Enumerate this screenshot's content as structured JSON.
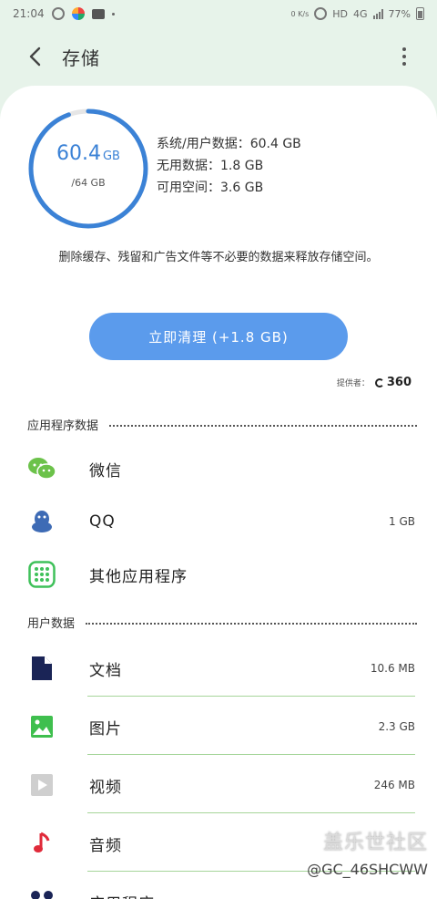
{
  "status_bar": {
    "time": "21:04",
    "net_speed": "0 K/s",
    "hd": "HD",
    "network": "4G",
    "battery": "77%"
  },
  "header": {
    "title": "存储"
  },
  "storage": {
    "used_value": "60.4",
    "used_unit": "GB",
    "total": "/64 GB",
    "used_fraction": 0.944,
    "system_user_data": "系统/用户数据：60.4 GB",
    "junk_data": "无用数据：1.8 GB",
    "available": "可用空间：3.6 GB"
  },
  "description": "删除缓存、残留和广告文件等不必要的数据来释放存储空间。",
  "clean_button": "立即清理 (+1.8 GB)",
  "provider": {
    "label": "提供者：",
    "brand": "360"
  },
  "app_data_section": {
    "title": "应用程序数据",
    "items": [
      {
        "name": "微信",
        "size": "",
        "icon": "wechat-icon"
      },
      {
        "name": "QQ",
        "size": "1 GB",
        "icon": "qq-icon"
      },
      {
        "name": "其他应用程序",
        "size": "",
        "icon": "apps-grid-icon"
      }
    ]
  },
  "user_data_section": {
    "title": "用户数据",
    "items": [
      {
        "name": "文档",
        "size": "10.6 MB",
        "icon": "document-icon"
      },
      {
        "name": "图片",
        "size": "2.3 GB",
        "icon": "image-icon"
      },
      {
        "name": "视频",
        "size": "246 MB",
        "icon": "video-icon"
      },
      {
        "name": "音频",
        "size": "",
        "icon": "audio-icon"
      },
      {
        "name": "应用程序",
        "size": "",
        "icon": "apps-icon"
      }
    ]
  },
  "watermark": {
    "line1": "盖乐世社区",
    "line2": "@GC_46SHCWW"
  },
  "colors": {
    "accent_blue": "#5b9bec",
    "gauge_blue": "#3b82d6",
    "divider_green": "#a6d59a",
    "background_mint": "#e7f3ea"
  }
}
